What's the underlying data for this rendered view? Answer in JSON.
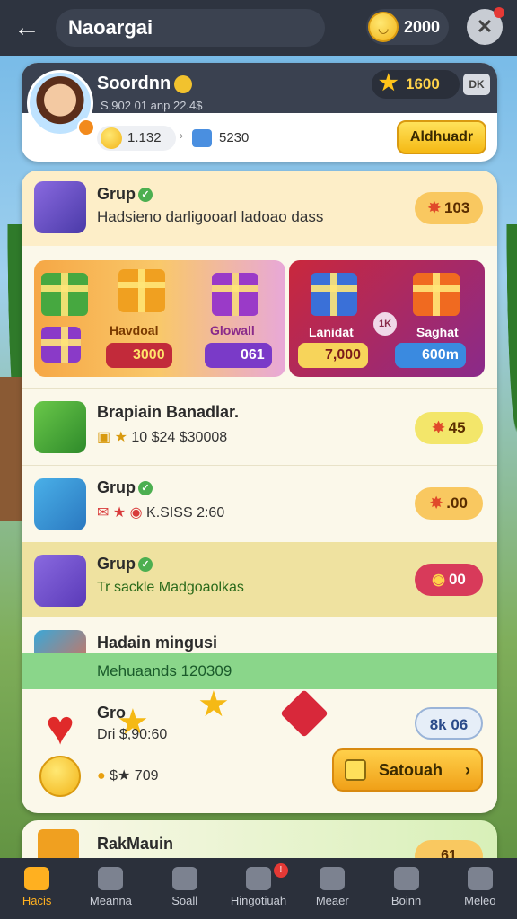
{
  "topbar": {
    "back_icon": "arrow-left-icon",
    "title": "Naoargai",
    "coins": "2000",
    "close_icon": "close-icon"
  },
  "profile": {
    "name": "Soordnn",
    "subtitle": "S,902 01 anp  22.4$",
    "stars": "1600",
    "tag": "DK",
    "stat1": "1.132",
    "stat2": "5230",
    "button": "Aldhuadr"
  },
  "groups": [
    {
      "title": "Grup",
      "subtitle": "Hadsieno darligooarl ladoao dass",
      "badge": "103"
    },
    {
      "title": "Brapiain Banadlar.",
      "subtitle": "10  $24 $30008",
      "badge": "45"
    },
    {
      "title": "Grup",
      "subtitle": "K.SISS 2:60",
      "badge": ".00"
    },
    {
      "title": "Grup",
      "subtitle": "Tr sackle Madgoaolkas",
      "badge": "00"
    },
    {
      "title": "Hadain mingusi",
      "subtitle": "Mehuaands 120309"
    },
    {
      "title": "Gro",
      "subtitle": "Dri    $,90:60",
      "badge": "8k 06"
    },
    {
      "title": "RakMauin",
      "badge": "61"
    }
  ],
  "gifts": {
    "left": [
      {
        "label": "Havdoal",
        "price": "3000"
      },
      {
        "label": "Glowall",
        "price": "061"
      }
    ],
    "right": [
      {
        "label": "Lanidat",
        "price": "7,000"
      },
      {
        "label": "Saghat",
        "price": "600m"
      }
    ],
    "mid_badge": "1K"
  },
  "bottom_stat": "$★ 709",
  "action_button": "Satouah",
  "nav": [
    "Hacis",
    "Meanna",
    "Soall",
    "Hingotiuah",
    "Meaer",
    "Boinn",
    "Meleo"
  ],
  "colors": {
    "accent": "#ffb020",
    "topbar": "#2e3440",
    "panel": "#fbf8ea"
  }
}
